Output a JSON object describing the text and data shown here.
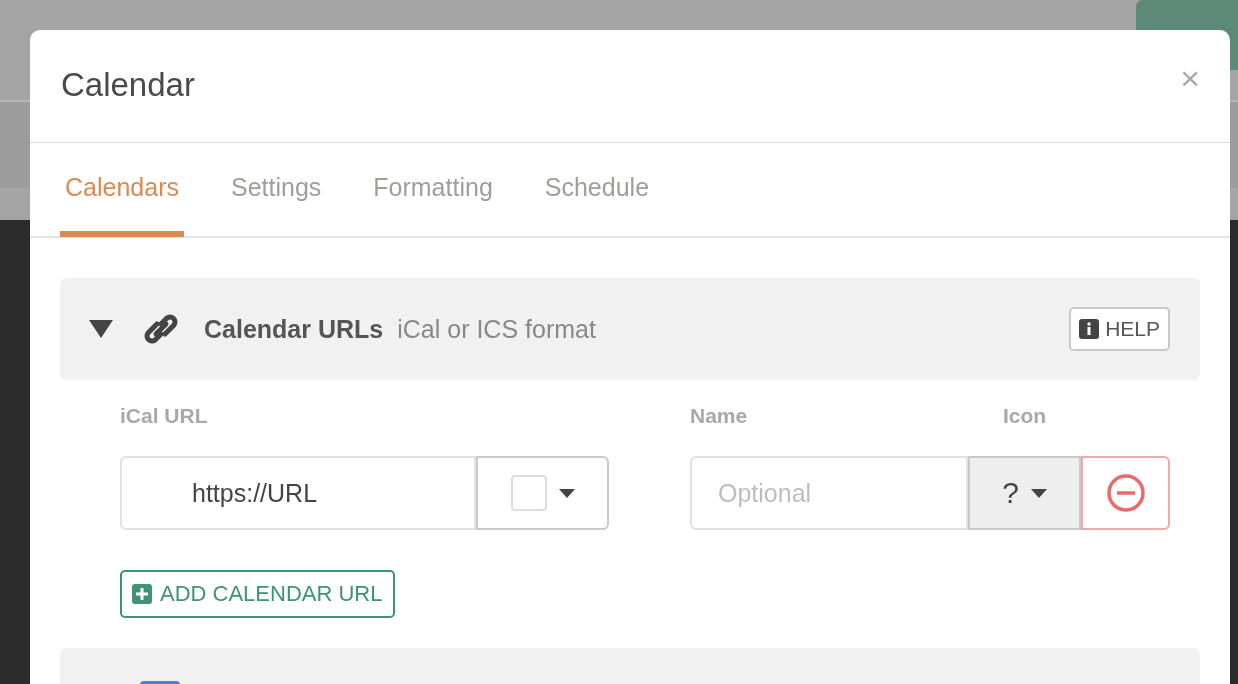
{
  "dialog": {
    "title": "Calendar",
    "close": "×"
  },
  "tabs": [
    {
      "label": "Calendars",
      "selected": true
    },
    {
      "label": "Settings",
      "selected": false
    },
    {
      "label": "Formatting",
      "selected": false
    },
    {
      "label": "Schedule",
      "selected": false
    }
  ],
  "section": {
    "expanded": true,
    "title": "Calendar URLs",
    "subtitle": "iCal or ICS format",
    "help": "HELP"
  },
  "columns": [
    "iCal URL",
    "Name",
    "Icon"
  ],
  "calendars": [
    {
      "url": "https://URL",
      "color": "#ffffff",
      "name_placeholder": "Optional",
      "icon": "?"
    }
  ],
  "add_button": "ADD CALENDAR URL"
}
